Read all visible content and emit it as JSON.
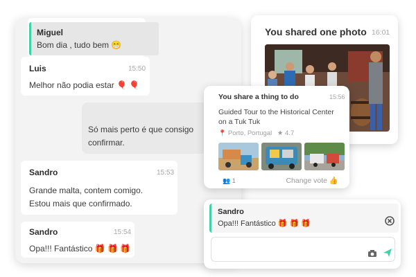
{
  "chat": {
    "messages": [
      {
        "sender": "Miguel",
        "text": "Bom dia , tudo bem",
        "emoji": "😁"
      },
      {
        "sender": "Luis",
        "time": "15:50",
        "text": "Melhor não podia estar",
        "emoji": "🎈 🎈"
      },
      {
        "text_line1": "Só mais perto é que consigo",
        "text_line2": "confirmar."
      },
      {
        "sender": "Sandro",
        "time": "15:53",
        "text_line1": "Grande malta, contem comigo.",
        "text_line2": "Estou mais que confirmado."
      },
      {
        "sender": "Sandro",
        "time": "15:54",
        "text": "Opa!!! Fantástico",
        "emoji": "🎁 🎁 🎁"
      }
    ]
  },
  "photo_card": {
    "title": "You shared one photo",
    "time": "16:01"
  },
  "todo_card": {
    "title": "You share a thing to do",
    "time": "15:56",
    "description": "Guided Tour to the Historical Center on a Tuk Tuk",
    "location": "Porto, Portugal",
    "rating": "4.7",
    "participants": "1",
    "change_vote_label": "Change vote"
  },
  "compose": {
    "reply_sender": "Sandro",
    "reply_text": "Opa!!! Fantástico",
    "reply_emoji": "🎁 🎁 🎁",
    "input_value": ""
  },
  "colors": {
    "accent": "#3fd2a6",
    "panel_bg": "#f3f3f3"
  }
}
